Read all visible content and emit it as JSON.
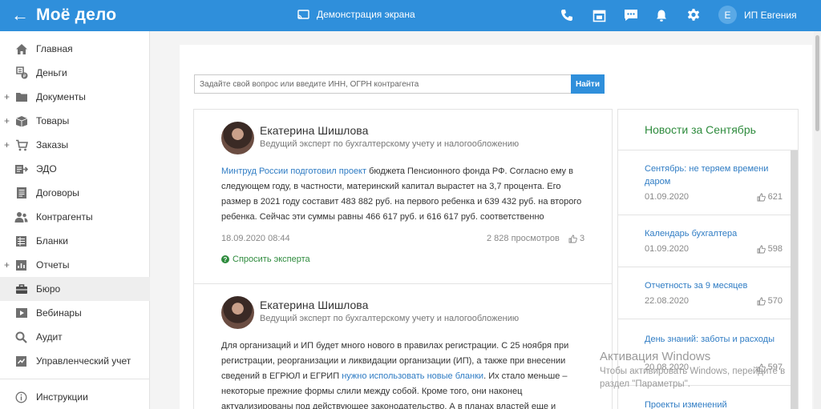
{
  "topbar": {
    "logo": "Моё дело",
    "demo_label": "Демонстрация экрана",
    "user_initial": "Е",
    "user_name": "ИП Евгения",
    "icons": [
      "phone-icon",
      "calendar-icon",
      "chat-icon",
      "bell-icon",
      "gear-icon"
    ]
  },
  "sidebar": {
    "items": [
      {
        "label": "Главная",
        "icon": "home-icon",
        "expandable": false,
        "active": false
      },
      {
        "label": "Деньги",
        "icon": "money-icon",
        "expandable": false,
        "active": false
      },
      {
        "label": "Документы",
        "icon": "folder-icon",
        "expandable": true,
        "active": false
      },
      {
        "label": "Товары",
        "icon": "box-icon",
        "expandable": true,
        "active": false
      },
      {
        "label": "Заказы",
        "icon": "cart-icon",
        "expandable": true,
        "active": false
      },
      {
        "label": "ЭДО",
        "icon": "edo-icon",
        "expandable": false,
        "active": false
      },
      {
        "label": "Договоры",
        "icon": "contract-icon",
        "expandable": false,
        "active": false
      },
      {
        "label": "Контрагенты",
        "icon": "people-icon",
        "expandable": false,
        "active": false
      },
      {
        "label": "Бланки",
        "icon": "forms-icon",
        "expandable": false,
        "active": false
      },
      {
        "label": "Отчеты",
        "icon": "report-icon",
        "expandable": true,
        "active": false
      },
      {
        "label": "Бюро",
        "icon": "briefcase-icon",
        "expandable": false,
        "active": true
      },
      {
        "label": "Вебинары",
        "icon": "video-icon",
        "expandable": false,
        "active": false
      },
      {
        "label": "Аудит",
        "icon": "audit-icon",
        "expandable": false,
        "active": false
      },
      {
        "label": "Управленческий учет",
        "icon": "management-icon",
        "expandable": false,
        "active": false
      }
    ],
    "instructions_label": "Инструкции"
  },
  "search": {
    "placeholder": "Задайте свой вопрос или введите ИНН, ОГРН контрагента",
    "button_label": "Найти"
  },
  "posts": [
    {
      "author": "Екатерина Шишлова",
      "role": "Ведущий эксперт по бухгалтерскому учету и налогообложению",
      "text_link1": "Минтруд России",
      "text_link2": "подготовил проект",
      "text_rest": " бюджета Пенсионного фонда РФ. Согласно ему в следующем году, в частности, материнский капитал вырастет на 3,7 процента. Его размер в 2021 году составит 483 882 руб. на первого ребенка и 639 432 руб. на второго ребенка. Сейчас эти суммы равны 466 617 руб. и 616 617 руб. соответственно",
      "date": "18.09.2020 08:44",
      "views": "2 828 просмотров",
      "likes": "3",
      "ask_label": "Спросить эксперта"
    },
    {
      "author": "Екатерина Шишлова",
      "role": "Ведущий эксперт по бухгалтерскому учету и налогообложению",
      "text_start": "Для организаций и ИП будет много нового в правилах регистрации. С 25 ноября при регистрации, реорганизации и ликвидации организации (ИП), а также при внесении сведений в ЕГРЮЛ и ЕГРИП ",
      "text_link": "нужно использовать новые бланки",
      "text_rest": ". Их стало меньше – некоторые прежние формы слили между собой. Кроме того, они наконец актуализированы под действующее законодательство. А в планах властей еще и"
    }
  ],
  "news": {
    "title": "Новости за Сентябрь",
    "items": [
      {
        "title": "Сентябрь: не теряем времени даром",
        "date": "01.09.2020",
        "likes": "621"
      },
      {
        "title": "Календарь бухгалтера",
        "date": "01.09.2020",
        "likes": "598"
      },
      {
        "title": "Отчетность за 9 месяцев",
        "date": "22.08.2020",
        "likes": "570"
      },
      {
        "title": "День знаний: заботы и расходы",
        "date": "20.08.2020",
        "likes": "597"
      },
      {
        "title": "Проекты изменений",
        "date": "",
        "likes": ""
      }
    ]
  },
  "watermark": {
    "title": "Активация Windows",
    "text": "Чтобы активировать Windows, перейдите в раздел \"Параметры\"."
  }
}
